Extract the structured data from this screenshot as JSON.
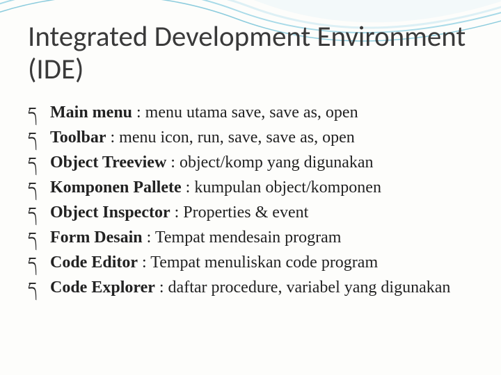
{
  "title": "Integrated Development Environment (IDE)",
  "bullets": [
    {
      "term": "Main menu",
      "desc": " : menu utama save, save as, open"
    },
    {
      "term": "Toolbar",
      "desc": " : menu icon, run, save, save as, open"
    },
    {
      "term": "Object Treeview",
      "desc": " : object/komp yang digunakan"
    },
    {
      "term": "Komponen Pallete",
      "desc": " : kumpulan object/komponen"
    },
    {
      "term": "Object Inspector",
      "desc": " : Properties & event"
    },
    {
      "term": "Form Desain",
      "desc": " : Tempat mendesain program"
    },
    {
      "term": "Code Editor",
      "desc": " : Tempat menuliskan code program"
    },
    {
      "term": "Code Explorer",
      "desc": " : daftar procedure, variabel yang digunakan"
    }
  ],
  "flourish": "ད"
}
